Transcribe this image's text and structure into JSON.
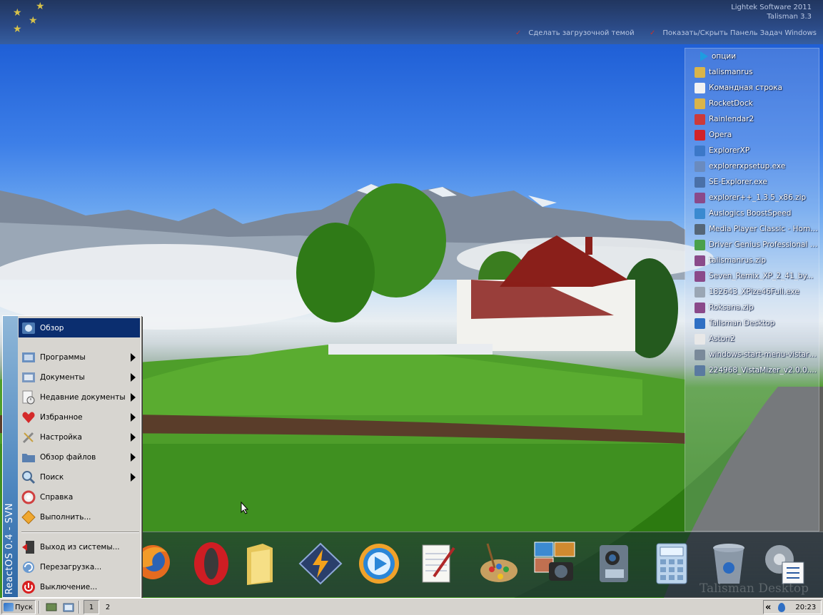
{
  "top_panel": {
    "brand_line1": "Lightek Software 2011",
    "brand_line2": "Talisman 3.3",
    "link_boot_theme": "Сделать загрузочной темой",
    "link_toggle_taskbar": "Показать/Скрыть Панель Задач Windows"
  },
  "desktop_list": {
    "options_label": "опции",
    "items": [
      {
        "label": "talismanrus",
        "icon": "folder-icon",
        "color": "#d9b44a"
      },
      {
        "label": "Командная строка",
        "icon": "document-icon",
        "color": "#f2f2f2"
      },
      {
        "label": "RocketDock",
        "icon": "folder-icon",
        "color": "#d9b44a"
      },
      {
        "label": "Rainlendar2",
        "icon": "calendar-icon",
        "color": "#cc3a3a"
      },
      {
        "label": "Opera",
        "icon": "opera-icon",
        "color": "#d2232a"
      },
      {
        "label": "ExplorerXP",
        "icon": "explorer-icon",
        "color": "#3c78c8"
      },
      {
        "label": "explorerxpsetup.exe",
        "icon": "installer-icon",
        "color": "#6a8bbf"
      },
      {
        "label": "SE-Explorer.exe",
        "icon": "app-icon",
        "color": "#4a70a8"
      },
      {
        "label": "explorer++_1.3.5_x86.zip",
        "icon": "archive-icon",
        "color": "#8a4a8a"
      },
      {
        "label": "Auslogics BoostSpeed",
        "icon": "globe-icon",
        "color": "#3a8ad0"
      },
      {
        "label": "Media Player Classic - Home...",
        "icon": "media-icon",
        "color": "#556677"
      },
      {
        "label": "Driver Genius Professional E...",
        "icon": "driver-icon",
        "color": "#4aa04a"
      },
      {
        "label": "talismanrus.zip",
        "icon": "archive-icon",
        "color": "#8a4a8a"
      },
      {
        "label": "Seven_Remix_XP_2_41_by...",
        "icon": "archive-icon",
        "color": "#8a4a8a"
      },
      {
        "label": "182643_XPize46Full.exe",
        "icon": "installer-icon",
        "color": "#9aa6b4"
      },
      {
        "label": "Roksana.zip",
        "icon": "archive-icon",
        "color": "#8a4a8a"
      },
      {
        "label": "Talisman Desktop",
        "icon": "talisman-icon",
        "color": "#2f6fc4"
      },
      {
        "label": "Aston2",
        "icon": "document-icon",
        "color": "#e8e8e8"
      },
      {
        "label": "windows-start-menu-vistart...",
        "icon": "app-icon",
        "color": "#7a8a9a"
      },
      {
        "label": "224968_VistaMizer_v2.0.0....",
        "icon": "installer-icon",
        "color": "#5a7aa0"
      }
    ]
  },
  "dock": {
    "caption": "Talisman Desktop",
    "icons": [
      "firefox-icon",
      "opera-icon",
      "folder-icon",
      "winamp-icon",
      "media-player-icon",
      "notepad-icon",
      "paint-icon",
      "photos-icon",
      "camcorder-icon",
      "calculator-icon",
      "recycle-bin-icon",
      "settings-icon"
    ]
  },
  "start_menu": {
    "banner": "ReactOS 0.4 - SVN",
    "items": [
      {
        "label": "Обзор",
        "icon": "browse-icon",
        "has_submenu": false
      },
      {
        "label": "Программы",
        "icon": "programs-icon",
        "has_submenu": true
      },
      {
        "label": "Документы",
        "icon": "documents-icon",
        "has_submenu": true
      },
      {
        "label": "Недавние документы",
        "icon": "recent-documents-icon",
        "has_submenu": true
      },
      {
        "label": "Избранное",
        "icon": "favorites-icon",
        "has_submenu": true
      },
      {
        "label": "Настройка",
        "icon": "settings-icon",
        "has_submenu": true
      },
      {
        "label": "Обзор файлов",
        "icon": "file-browser-icon",
        "has_submenu": true
      },
      {
        "label": "Поиск",
        "icon": "search-icon",
        "has_submenu": true
      },
      {
        "label": "Справка",
        "icon": "help-icon",
        "has_submenu": false
      },
      {
        "label": "Выполнить...",
        "icon": "run-icon",
        "has_submenu": false
      },
      {
        "label": "Выход из системы...",
        "icon": "logoff-icon",
        "has_submenu": false
      },
      {
        "label": "Перезагрузка...",
        "icon": "restart-icon",
        "has_submenu": false
      },
      {
        "label": "Выключение...",
        "icon": "shutdown-icon",
        "has_submenu": false
      }
    ]
  },
  "taskbar": {
    "start_label": "Пуск",
    "workspace_1": "1",
    "workspace_2": "2",
    "tray_chevron": "«",
    "clock": "20:23"
  }
}
